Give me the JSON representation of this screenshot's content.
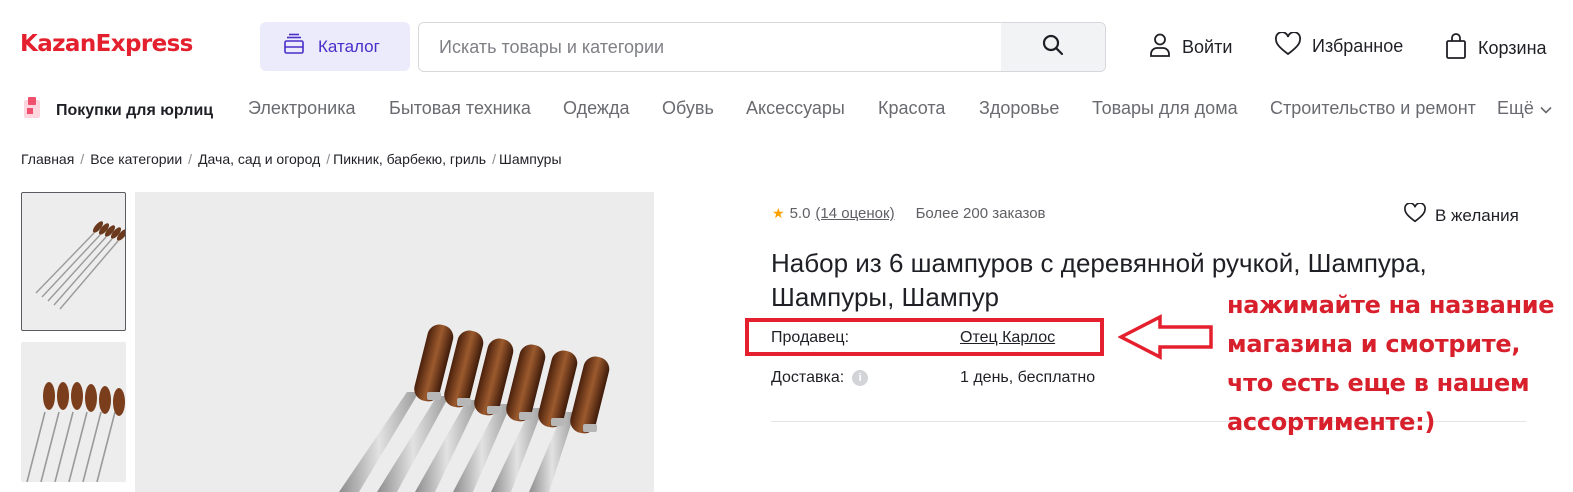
{
  "header": {
    "logo_part1": "Kazan",
    "logo_part2": "Express",
    "catalog_label": "Каталог",
    "search_placeholder": "Искать товары и категории",
    "login_label": "Войти",
    "favorites_label": "Избранное",
    "cart_label": "Корзина"
  },
  "nav": {
    "b2b_label": "Покупки для юрлиц",
    "categories": [
      "Электроника",
      "Бытовая техника",
      "Одежда",
      "Обувь",
      "Аксессуары",
      "Красота",
      "Здоровье",
      "Товары для дома",
      "Строительство и ремонт"
    ],
    "more_label": "Ещё"
  },
  "breadcrumbs": [
    "Главная",
    "Все категории",
    "Дача, сад и огород",
    "Пикник, барбекю, гриль",
    "Шампуры"
  ],
  "product": {
    "rating": "5.0",
    "reviews": "(14 оценок)",
    "orders": "Более 200 заказов",
    "wishlist_label": "В желания",
    "title": "Набор из 6 шампуров с деревянной ручкой, Шампура, Шампуры, Шампур",
    "seller_label": "Продавец:",
    "seller_name": "Отец Карлос",
    "delivery_label": "Доставка:",
    "delivery_value": "1 день, бесплатно"
  },
  "annotation": {
    "text": "нажимайте на название магазина и смотрите, что есть еще в нашем ассортименте:)"
  },
  "colors": {
    "brand_red": "#e5202e",
    "brand_purple": "#7000ff",
    "catalog_bg": "#ebebfb",
    "annotation_red": "#d8202d",
    "star": "#ffa000"
  }
}
